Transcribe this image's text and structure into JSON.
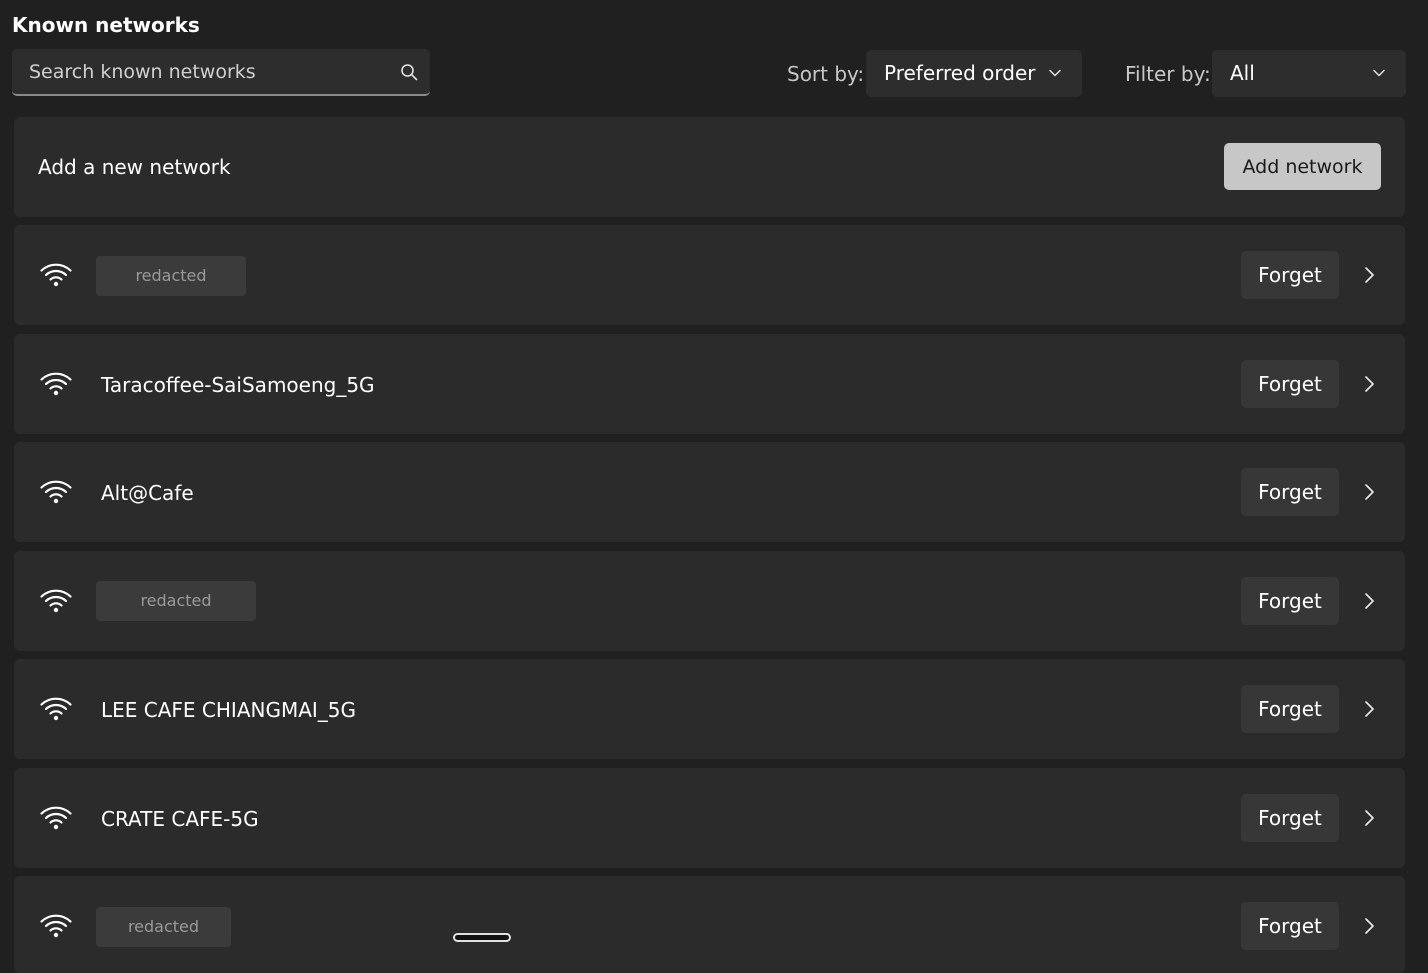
{
  "header": {
    "title": "Known networks"
  },
  "search": {
    "placeholder": "Search known networks",
    "value": ""
  },
  "sort": {
    "label": "Sort by:",
    "selected": "Preferred order"
  },
  "filter": {
    "label": "Filter by:",
    "selected": "All"
  },
  "add_network": {
    "text": "Add a new network",
    "button_label": "Add network"
  },
  "networks": [
    {
      "name": "redacted",
      "redacted": true,
      "forget_label": "Forget"
    },
    {
      "name": "Taracoffee-SaiSamoeng_5G",
      "redacted": false,
      "forget_label": "Forget"
    },
    {
      "name": "Alt@Cafe",
      "redacted": false,
      "forget_label": "Forget"
    },
    {
      "name": "redacted",
      "redacted": true,
      "forget_label": "Forget"
    },
    {
      "name": "LEE CAFE CHIANGMAI_5G",
      "redacted": false,
      "forget_label": "Forget"
    },
    {
      "name": "CRATE CAFE-5G",
      "redacted": false,
      "forget_label": "Forget"
    },
    {
      "name": "redacted",
      "redacted": true,
      "forget_label": "Forget"
    }
  ],
  "icons": {
    "search": "search-icon",
    "dropdown": "chevron-down-icon",
    "network": "wifi-icon",
    "row_action": "chevron-right-icon"
  }
}
